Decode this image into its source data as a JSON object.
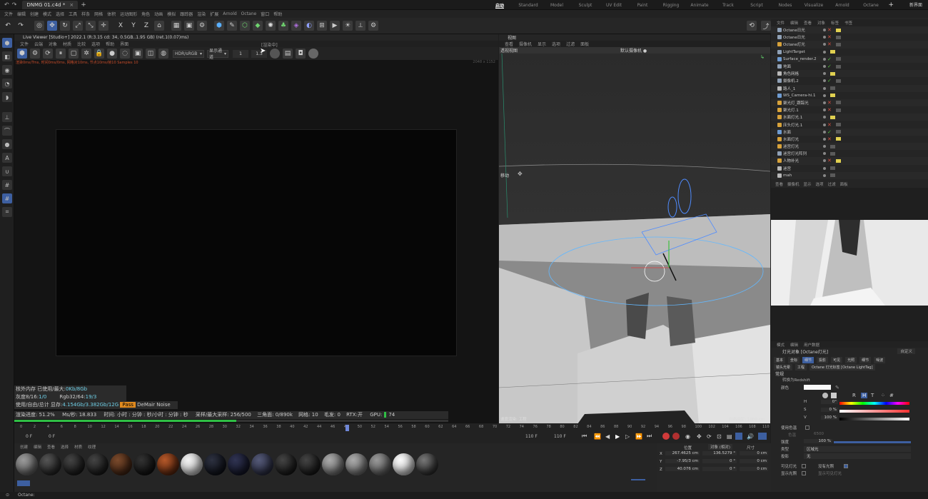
{
  "window": {
    "tab": "DNMG 01.c4d *",
    "layouts": [
      "启动",
      "Standard",
      "Model",
      "Sculpt",
      "UV Edit",
      "Paint",
      "Rigging",
      "Animate",
      "Track",
      "Script",
      "Nodes",
      "Visualize",
      "Arnold",
      "Octane"
    ],
    "new_layout": "新界面"
  },
  "menubar": {
    "items": [
      "文件",
      "编辑",
      "创建",
      "模式",
      "选择",
      "工具",
      "样条",
      "网格",
      "体积",
      "运动图形",
      "角色",
      "动画",
      "模拟",
      "跟踪器",
      "渲染",
      "扩展",
      "Arnold",
      "Octane",
      "窗口",
      "帮助"
    ]
  },
  "toolbar": {
    "axis": [
      "X",
      "Y",
      "Z"
    ]
  },
  "live_viewer": {
    "title": "Live Viewer [Studio+] 2022.1 (R:3.15 cd: 34, 0.5GB..1.95 GB) (ret.1(0.07)ms)",
    "menu": [
      "文件",
      "云端",
      "对象",
      "材质",
      "比较",
      "选项",
      "帮助",
      "界面"
    ],
    "color_mode": "HDR/sRGB",
    "view_mode": "显示通道",
    "field_a": "1",
    "field_b": "1.3",
    "render_label": "[渲染中]",
    "status_line": "渲染0ms/Trns, 时间0ms/0ms, 网格对10ms, 节点10ms/帧10 Samples 10",
    "status_right": "2048 x 1152",
    "stats": {
      "memory": "核外内存 已使用/最大:",
      "memory_val": "0Kb/8Gb",
      "grey": "灰度8/16:",
      "grey_val": "1/0",
      "rgb": "Rgb32/64:",
      "rgb_val": "19/3",
      "vram": "使用/自由/总计 显存:",
      "vram_val": "4.154Gb/3.382Gb/12G",
      "denoise_tag": "Pass",
      "denoise": "DeMair Noise"
    },
    "progress": {
      "text1": "渲染进度: 51.2%",
      "ms": "Ms/秒: 18.833",
      "time": "时间: 小时 : 分钟 : 秒/小时 : 分钟 : 秒",
      "samples": "采样/最大采样: 256/500",
      "tris": "三角面: 0/890k",
      "mesh": "网格: 10",
      "hair": "毛发: 0",
      "rtx": "RTX:开",
      "gpu": "GPU:",
      "gpu_val": "74"
    }
  },
  "viewport": {
    "title": "视图",
    "menu": [
      "查看",
      "摄像机",
      "显示",
      "选项",
      "过滤",
      "面板"
    ],
    "view_name": "透视视图",
    "camera": "默认摄像机 ●",
    "move_label": "移动",
    "footer_left": "速度渲染: 工程",
    "footer_right": "网格间距: 1000 cm"
  },
  "objects": {
    "menu": [
      "文件",
      "编辑",
      "查看",
      "对象",
      "标签",
      "书签"
    ],
    "items": [
      {
        "name": "Octane日光",
        "icon": "#8fa0b5",
        "vis": "x"
      },
      {
        "name": "Octane日光",
        "icon": "#8fa0b5",
        "vis": "x"
      },
      {
        "name": "Octane灯光",
        "icon": "#d7a23a",
        "vis": "x"
      },
      {
        "name": "LightTarget",
        "icon": "#8fa0b5",
        "vis": ""
      },
      {
        "name": "Surface_render.2",
        "icon": "#6e9bd1",
        "vis": "c"
      },
      {
        "name": "地面",
        "icon": "#8fa0b5",
        "vis": "c"
      },
      {
        "name": "角色网格",
        "icon": "#b8b8b8",
        "vis": ""
      },
      {
        "name": "摄像机.2",
        "icon": "#8fa0b5",
        "vis": "c"
      },
      {
        "name": "路人_1",
        "icon": "#b8b8b8",
        "vis": ""
      },
      {
        "name": "WS_Camera-hi.1",
        "icon": "#6e9bd1",
        "vis": ""
      },
      {
        "name": "聚光灯_跟踪光",
        "icon": "#d7a23a",
        "vis": "x"
      },
      {
        "name": "聚光灯.1",
        "icon": "#d7a23a",
        "vis": "x"
      },
      {
        "name": "水面灯光.1",
        "icon": "#d7a23a",
        "vis": ""
      },
      {
        "name": "床头灯光.1",
        "icon": "#d7a23a",
        "vis": "x"
      },
      {
        "name": "水面",
        "icon": "#6e9bd1",
        "vis": "c"
      },
      {
        "name": "水面灯光",
        "icon": "#d7a23a",
        "vis": "x"
      },
      {
        "name": "迷宫灯光",
        "icon": "#d7a23a",
        "vis": ""
      },
      {
        "name": "迷宫灯光阵列",
        "icon": "#8fa0b5",
        "vis": ""
      },
      {
        "name": "人物补光",
        "icon": "#d7a23a",
        "vis": "x"
      },
      {
        "name": "迷宫",
        "icon": "#b8b8b8",
        "vis": ""
      },
      {
        "name": "mah",
        "icon": "#b8b8b8",
        "vis": ""
      }
    ]
  },
  "preview": {
    "menu": [
      "查看",
      "摄像机",
      "显示",
      "选项",
      "过滤",
      "面板"
    ]
  },
  "attributes": {
    "menu": [
      "模式",
      "编辑",
      "用户数据"
    ],
    "title": "灯光对象 [Octane灯光]",
    "preset": "自定义",
    "tabs": [
      "基本",
      "坐标",
      "细节",
      "投影",
      "可见",
      "光照",
      "细节",
      "噪波"
    ],
    "subtabs": [
      "镜头光晕",
      "工程",
      "Octane 灯光标签 [Octane LightTag]"
    ],
    "section": "常规",
    "convert": "转换为Redshift",
    "color_label": "颜色",
    "h_label": "H",
    "h_val": "0°",
    "s_label": "S",
    "s_val": "0 %",
    "v_label": "V",
    "v_val": "100 %",
    "use_temp": "使用色温",
    "temp": "色温",
    "temp_val": "6500",
    "intensity": "强度",
    "intensity_val": "100 %",
    "type": "类型",
    "type_val": "区域光",
    "shadow": "投影",
    "shadow_val": "无",
    "visible_light": "可见灯光",
    "no_light": "没有光照",
    "show_light": "显示光照",
    "ambient": "环境光照",
    "show_vis": "显示可见灯光"
  },
  "timeline": {
    "ticks": [
      "0",
      "2",
      "4",
      "6",
      "8",
      "10",
      "12",
      "14",
      "16",
      "18",
      "20",
      "22",
      "24",
      "26",
      "28",
      "30",
      "32",
      "34",
      "36",
      "38",
      "40",
      "42",
      "44",
      "46",
      "48",
      "50",
      "52",
      "54",
      "56",
      "58",
      "60",
      "62",
      "64",
      "66",
      "68",
      "70",
      "72",
      "74",
      "76",
      "78",
      "80",
      "82",
      "84",
      "86",
      "88",
      "90",
      "92",
      "94",
      "96",
      "98",
      "100",
      "102",
      "104",
      "106",
      "108",
      "110"
    ],
    "frame_a": "0 F",
    "frame_b": "0 F",
    "end_a": "110 F",
    "end_b": "110 F",
    "current": "50 F"
  },
  "materials": {
    "menu": [
      "创建",
      "编辑",
      "查看",
      "选择",
      "材质",
      "纹理"
    ],
    "balls": [
      {
        "c1": "#9a9a9a",
        "c2": "#4a4a4a",
        "label": "OctGlo"
      },
      {
        "c1": "#555",
        "c2": "#111",
        "label": "Octane"
      },
      {
        "c1": "#444",
        "c2": "#0a0a0a",
        "label": "Octane"
      },
      {
        "c1": "#444",
        "c2": "#0a0a0a",
        "label": "Octane"
      },
      {
        "c1": "#7a4a2c",
        "c2": "#2a150a",
        "label": "Octane"
      },
      {
        "c1": "#333",
        "c2": "#050505",
        "label": "Octane"
      },
      {
        "c1": "#b4582a",
        "c2": "#3a1505",
        "label": "Octane"
      },
      {
        "c1": "#f2f2f2",
        "c2": "#aaa",
        "label": "Octane"
      },
      {
        "c1": "#2d3140",
        "c2": "#05070c",
        "label": "Octane"
      },
      {
        "c1": "#303452",
        "c2": "#0a0b18",
        "label": "Octane"
      },
      {
        "c1": "#555a78",
        "c2": "#1a1c2c",
        "label": "Octane"
      },
      {
        "c1": "#444",
        "c2": "#080808",
        "label": "Octane"
      },
      {
        "c1": "#444",
        "c2": "#080808",
        "label": "Octane"
      },
      {
        "c1": "#aaa",
        "c2": "#555",
        "label": "Octane"
      },
      {
        "c1": "#aaa",
        "c2": "#555",
        "label": "Octane"
      },
      {
        "c1": "#999",
        "c2": "#444",
        "label": "Octane"
      },
      {
        "c1": "#fafafa",
        "c2": "#aaa",
        "label": "Octane"
      },
      {
        "c1": "#777",
        "c2": "#111",
        "label": "Octane"
      }
    ]
  },
  "coords": {
    "headers": [
      "位置",
      "尺寸",
      "旋转"
    ],
    "labels": [
      "X",
      "Y",
      "Z"
    ],
    "pos": [
      "267.4625 cm",
      "-7.95/3 cm",
      "40.076 cm"
    ],
    "size": [
      "136.5279 °",
      "0 °",
      "0 °"
    ],
    "rot": [
      "0 cm",
      "0 cm",
      "0 cm"
    ],
    "mode": "对象 (相对)",
    "size_mode": "尺寸",
    "apply": "应用"
  },
  "status": {
    "text": "Octane:"
  },
  "colors": {
    "accent": "#3d5fa0",
    "progress": "#2fbf45",
    "render_bg": "#060606"
  }
}
